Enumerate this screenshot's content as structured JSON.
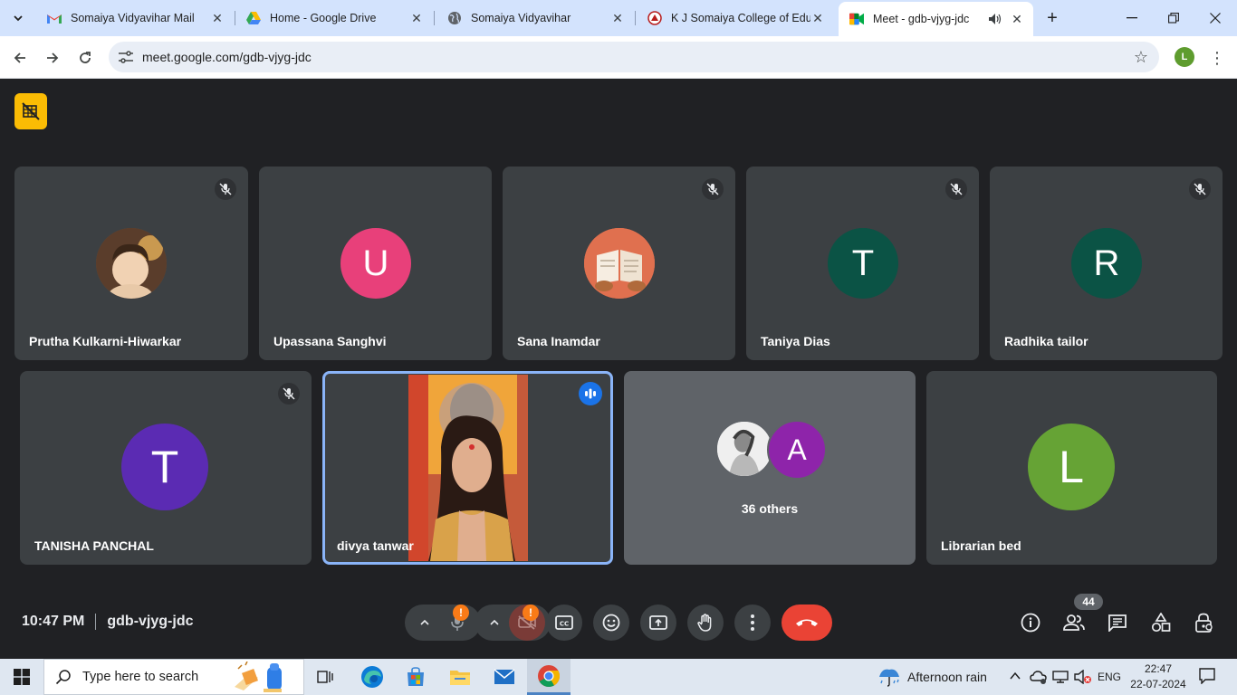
{
  "browser": {
    "tabs": [
      {
        "title": "Somaiya Vidyavihar Mail",
        "icon": "gmail-icon"
      },
      {
        "title": "Home - Google Drive",
        "icon": "google-drive-icon"
      },
      {
        "title": "Somaiya Vidyavihar",
        "icon": "globe-icon"
      },
      {
        "title": "K J Somaiya College of Educ",
        "icon": "college-logo-icon"
      },
      {
        "title": "Meet - gdb-vjyg-jdc",
        "icon": "google-meet-icon",
        "active": true,
        "audio": "speaker-icon"
      }
    ],
    "url": "meet.google.com/gdb-vjyg-jdc",
    "profile_initial": "L"
  },
  "meet": {
    "participants_row1": [
      {
        "name": "Prutha Kulkarni-Hiwarkar",
        "avatar_type": "photo",
        "muted": true
      },
      {
        "name": "Upassana Sanghvi",
        "initial": "U",
        "color": "#e8407a",
        "muted": false
      },
      {
        "name": "Sana Inamdar",
        "avatar_type": "photo",
        "muted": true
      },
      {
        "name": "Taniya Dias",
        "initial": "T",
        "color": "#0b5345",
        "muted": true
      },
      {
        "name": "Radhika tailor",
        "initial": "R",
        "color": "#0b5345",
        "muted": true
      }
    ],
    "participants_row2": [
      {
        "name": "TANISHA PANCHAL",
        "initial": "T",
        "color": "#5b2bb3",
        "muted": true
      },
      {
        "name": "divya tanwar",
        "video": true,
        "speaking": true
      },
      {
        "name": "36 others",
        "group": true,
        "initial": "A",
        "color": "#8e24aa"
      },
      {
        "name": "Librarian bed",
        "initial": "L",
        "color": "#66a335"
      }
    ],
    "time": "10:47 PM",
    "code": "gdb-vjyg-jdc",
    "people_count": "44",
    "colors": {
      "end_call": "#ea4335",
      "speaking": "#1a73e8",
      "warning": "#fa7b17",
      "yellow_badge": "#fbbc04"
    }
  },
  "taskbar": {
    "search_placeholder": "Type here to search",
    "weather": "Afternoon rain",
    "language": "ENG",
    "clock_time": "22:47",
    "clock_date": "22-07-2024"
  }
}
